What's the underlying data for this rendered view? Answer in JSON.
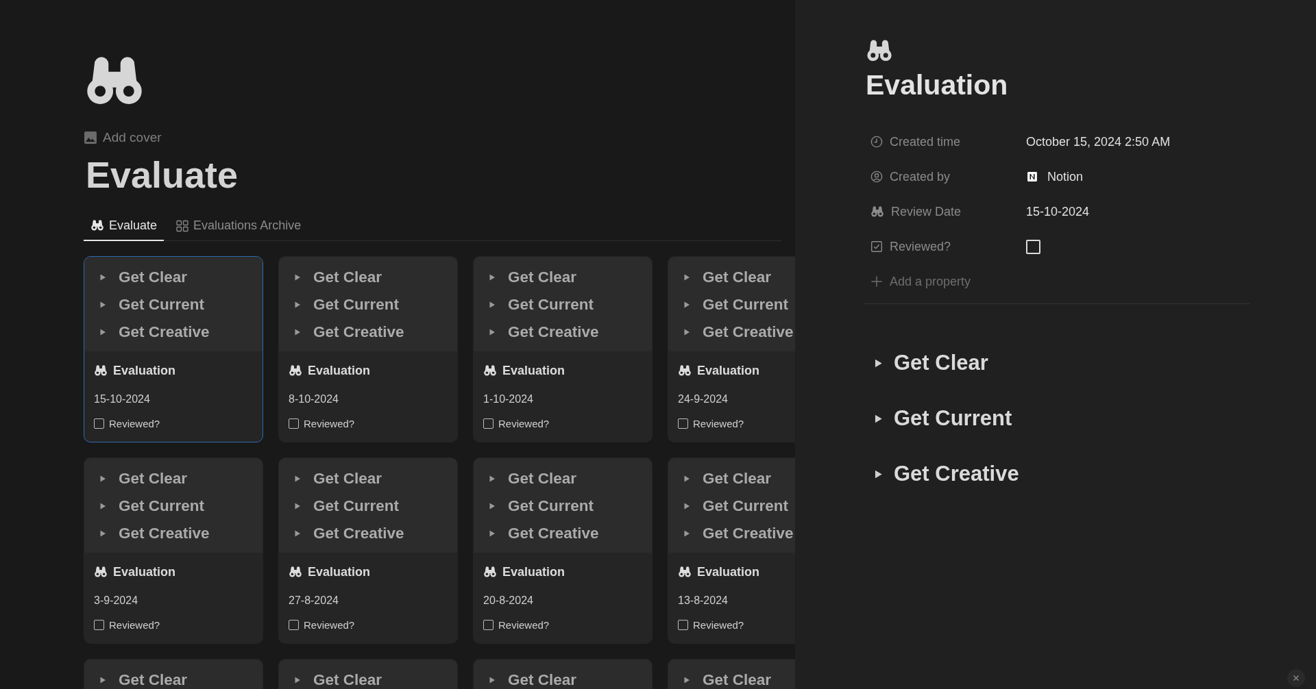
{
  "page": {
    "title": "Evaluate",
    "add_cover": "Add cover",
    "tabs": [
      {
        "label": "Evaluate",
        "kind": "binoculars",
        "selected": true
      },
      {
        "label": "Evaluations Archive",
        "kind": "gallery",
        "selected": false
      }
    ],
    "cards": [
      {
        "toggles": [
          "Get Clear",
          "Get Current",
          "Get Creative"
        ],
        "title": "Evaluation",
        "date": "15-10-2024",
        "reviewed_label": "Reviewed?",
        "reviewed": false,
        "selected": true
      },
      {
        "toggles": [
          "Get Clear",
          "Get Current",
          "Get Creative"
        ],
        "title": "Evaluation",
        "date": "8-10-2024",
        "reviewed_label": "Reviewed?",
        "reviewed": false,
        "selected": false
      },
      {
        "toggles": [
          "Get Clear",
          "Get Current",
          "Get Creative"
        ],
        "title": "Evaluation",
        "date": "1-10-2024",
        "reviewed_label": "Reviewed?",
        "reviewed": false,
        "selected": false
      },
      {
        "toggles": [
          "Get Clear",
          "Get Current",
          "Get Creative"
        ],
        "title": "Evaluation",
        "date": "24-9-2024",
        "reviewed_label": "Reviewed?",
        "reviewed": false,
        "selected": false
      },
      {
        "toggles": [
          "Get Clear",
          "Get Current",
          "Get Creative"
        ],
        "title": "Evaluation",
        "date": "3-9-2024",
        "reviewed_label": "Reviewed?",
        "reviewed": false,
        "selected": false
      },
      {
        "toggles": [
          "Get Clear",
          "Get Current",
          "Get Creative"
        ],
        "title": "Evaluation",
        "date": "27-8-2024",
        "reviewed_label": "Reviewed?",
        "reviewed": false,
        "selected": false
      },
      {
        "toggles": [
          "Get Clear",
          "Get Current",
          "Get Creative"
        ],
        "title": "Evaluation",
        "date": "20-8-2024",
        "reviewed_label": "Reviewed?",
        "reviewed": false,
        "selected": false
      },
      {
        "toggles": [
          "Get Clear",
          "Get Current",
          "Get Creative"
        ],
        "title": "Evaluation",
        "date": "13-8-2024",
        "reviewed_label": "Reviewed?",
        "reviewed": false,
        "selected": false
      },
      {
        "toggles": [
          "Get Clear"
        ],
        "selected": false
      },
      {
        "toggles": [
          "Get Clear"
        ],
        "selected": false
      },
      {
        "toggles": [
          "Get Clear"
        ],
        "selected": false
      },
      {
        "toggles": [
          "Get Clear"
        ],
        "selected": false
      }
    ]
  },
  "panel": {
    "title": "Evaluation",
    "properties": [
      {
        "kind": "created_time",
        "label": "Created time",
        "value": "October 15, 2024 2:50 AM"
      },
      {
        "kind": "created_by",
        "label": "Created by",
        "value": "Notion"
      },
      {
        "kind": "date",
        "label": "Review Date",
        "value": "15-10-2024"
      },
      {
        "kind": "checkbox",
        "label": "Reviewed?",
        "checked": false
      }
    ],
    "add_property": "Add a property",
    "toggles": [
      "Get Clear",
      "Get Current",
      "Get Creative"
    ]
  }
}
